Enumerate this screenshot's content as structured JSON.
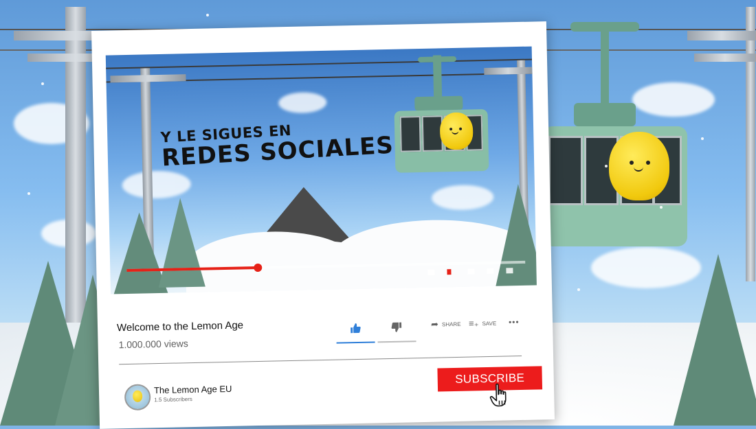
{
  "video": {
    "caption_line1": "Y LE SIGUES EN",
    "caption_line2": "REDES SOCIALES...",
    "progress": 0.33
  },
  "video_info": {
    "title": "Welcome to the Lemon Age",
    "views": "1.000.000 views"
  },
  "actions": {
    "share_label": "SHARE",
    "save_label": "SAVE",
    "more_label": "•••"
  },
  "channel": {
    "name": "The Lemon Age EU",
    "subscribers": "1.5 Subscribers"
  },
  "subscribe": {
    "label": "SUBSCRIBE"
  },
  "icons": {
    "like": "thumbs-up-icon",
    "dislike": "thumbs-down-icon",
    "share": "share-arrow-icon",
    "save": "playlist-add-icon",
    "cursor": "hand-pointer-icon"
  },
  "colors": {
    "subscribe_red": "#ec1c1c",
    "progress_red": "#e62117",
    "like_blue": "#2f7fd9"
  }
}
